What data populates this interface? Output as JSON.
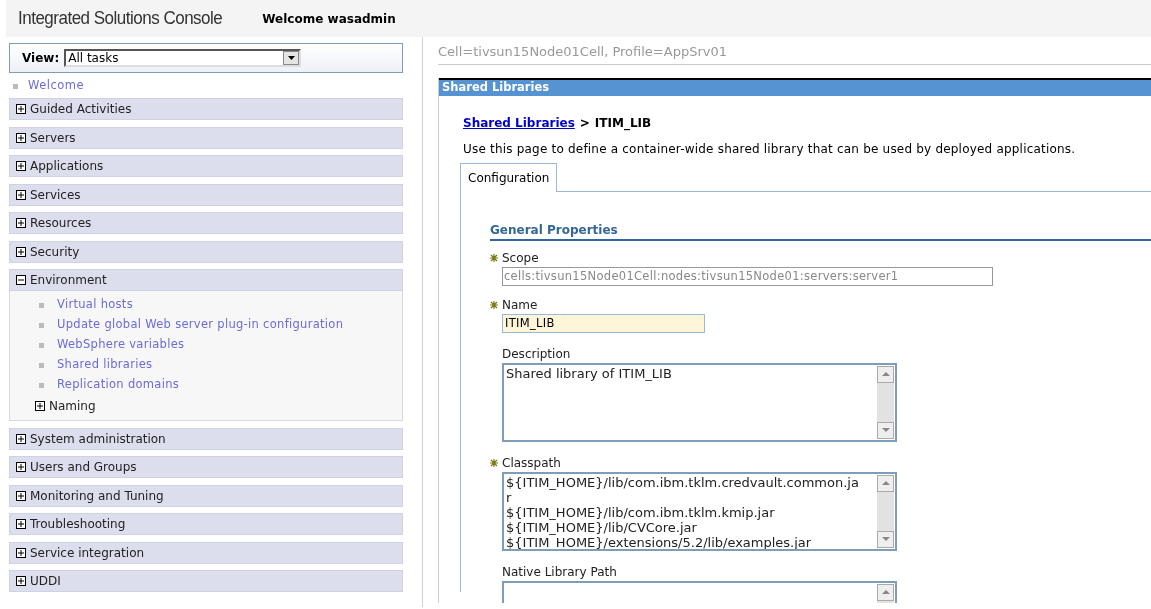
{
  "header": {
    "title": "Integrated Solutions Console",
    "welcome": "Welcome wasadmin"
  },
  "nav": {
    "view_label": "View:",
    "view_value": "All tasks",
    "welcome_link": "Welcome",
    "sections": [
      {
        "label": "Guided Activities",
        "expanded": false
      },
      {
        "label": "Servers",
        "expanded": false
      },
      {
        "label": "Applications",
        "expanded": false
      },
      {
        "label": "Services",
        "expanded": false
      },
      {
        "label": "Resources",
        "expanded": false
      },
      {
        "label": "Security",
        "expanded": false
      },
      {
        "label": "Environment",
        "expanded": true,
        "children": [
          {
            "kind": "link",
            "label": "Virtual hosts"
          },
          {
            "kind": "link",
            "label": "Update global Web server plug-in configuration"
          },
          {
            "kind": "link",
            "label": "WebSphere variables"
          },
          {
            "kind": "link",
            "label": "Shared libraries"
          },
          {
            "kind": "link",
            "label": "Replication domains"
          },
          {
            "kind": "group",
            "label": "Naming",
            "expanded": false
          }
        ]
      },
      {
        "label": "System administration",
        "expanded": false
      },
      {
        "label": "Users and Groups",
        "expanded": false
      },
      {
        "label": "Monitoring and Tuning",
        "expanded": false
      },
      {
        "label": "Troubleshooting",
        "expanded": false
      },
      {
        "label": "Service integration",
        "expanded": false
      },
      {
        "label": "UDDI",
        "expanded": false
      }
    ]
  },
  "content": {
    "scope_path": "Cell=tivsun15Node01Cell, Profile=AppSrv01",
    "panel_title": "Shared Libraries",
    "breadcrumb": {
      "link": "Shared Libraries",
      "separator": ">",
      "current": "ITIM_LIB"
    },
    "description": "Use this page to define a container-wide shared library that can be used by deployed applications.",
    "tabs": [
      {
        "label": "Configuration",
        "selected": true
      }
    ],
    "section_title": "General Properties",
    "fields": [
      {
        "kind": "text",
        "label": "Scope",
        "required": true,
        "disabled": true,
        "value": "cells:tivsun15Node01Cell:nodes:tivsun15Node01:servers:server1"
      },
      {
        "kind": "text",
        "label": "Name",
        "required": true,
        "disabled": false,
        "value": "ITIM_LIB"
      },
      {
        "kind": "textarea",
        "label": "Description",
        "required": false,
        "value": "Shared library of ITIM_LIB"
      },
      {
        "kind": "textarea",
        "label": "Classpath",
        "required": true,
        "value": "${ITIM_HOME}/lib/com.ibm.tklm.credvault.common.jar\n${ITIM_HOME}/lib/com.ibm.tklm.kmip.jar\n${ITIM_HOME}/lib/CVCore.jar\n${ITIM_HOME}/extensions/5.2/lib/examples.jar"
      },
      {
        "kind": "textarea",
        "label": "Native Library Path",
        "required": false
      }
    ]
  }
}
